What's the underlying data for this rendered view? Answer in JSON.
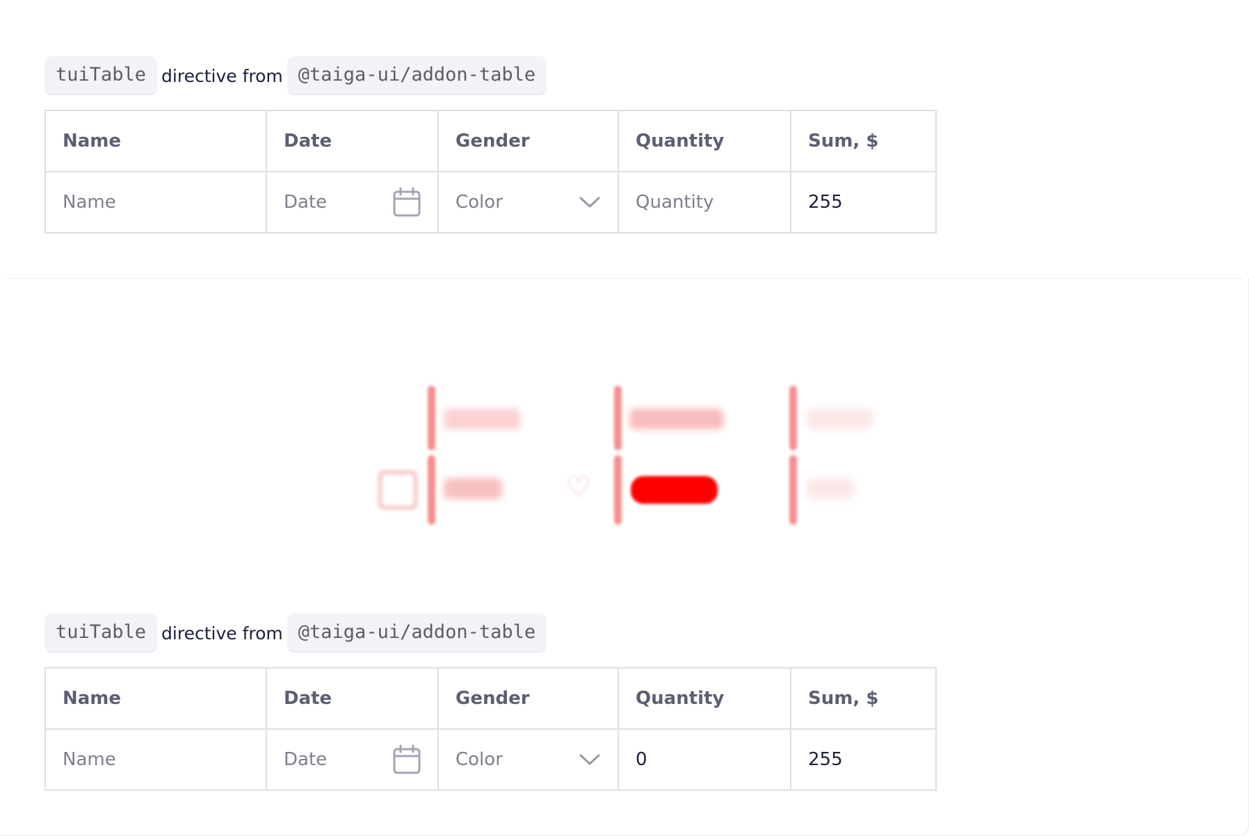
{
  "caption": {
    "directive": "tuiTable",
    "middle": "directive from",
    "package": "@taiga-ui/addon-table"
  },
  "table_top": {
    "headers": [
      "Name",
      "Date",
      "Gender",
      "Quantity",
      "Sum, $"
    ],
    "row": {
      "name_placeholder": "Name",
      "date_placeholder": "Date",
      "gender_placeholder": "Color",
      "quantity_placeholder": "Quantity",
      "sum": "255"
    }
  },
  "table_bottom": {
    "headers": [
      "Name",
      "Date",
      "Gender",
      "Quantity",
      "Sum, $"
    ],
    "row": {
      "name_placeholder": "Name",
      "date_placeholder": "Date",
      "gender_placeholder": "Color",
      "quantity": "0",
      "sum": "255"
    }
  },
  "icons": {
    "date": "calendar-icon",
    "gender": "chevron-down-icon",
    "animation": "heart-icon"
  },
  "colors": {
    "accent_blur": "#ff0000",
    "border": "#dedee3",
    "code_bg": "#f2f3f7"
  }
}
